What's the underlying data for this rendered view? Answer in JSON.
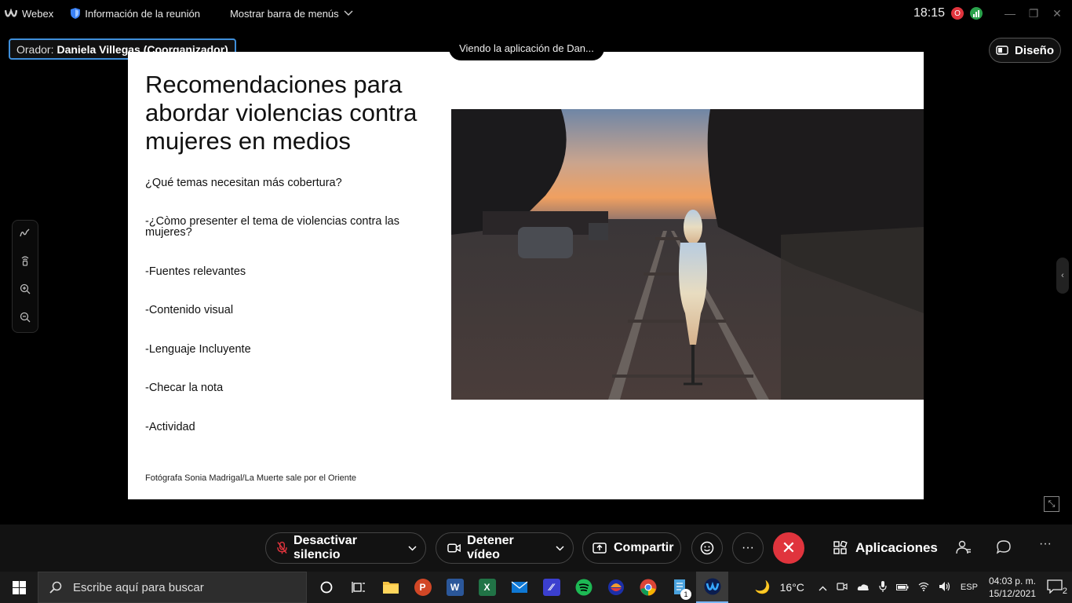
{
  "window": {
    "app_name": "Webex",
    "meeting_info": "Información de la reunión",
    "menu_bar": "Mostrar barra de menús",
    "clock": "18:15",
    "rec_badge": "O"
  },
  "presenter": {
    "prefix": "Orador:",
    "name": "Daniela Villegas (Coorganizador)"
  },
  "viewing_label": "Viendo la aplicación de Dan...",
  "layout_button": "Diseño",
  "slide": {
    "title": "Recomendaciones para abordar violencias contra mujeres en medios",
    "bullets": [
      "¿Qué temas necesitan más cobertura?",
      "-¿Còmo presenter el tema de violencias contra las mujeres?",
      "-Fuentes relevantes",
      "-Contenido visual",
      "-Lenguaje Incluyente",
      "-Checar la nota",
      "-Actividad"
    ],
    "credit": "Fotógrafa Sonia Madrigal/La Muerte sale por el Oriente"
  },
  "controls": {
    "mute": "Desactivar silencio",
    "video": "Detener vídeo",
    "share": "Compartir",
    "apps": "Aplicaciones"
  },
  "taskbar": {
    "search_placeholder": "Escribe aquí para buscar",
    "weather": "16°C",
    "lang": "ESP",
    "time": "04:03 p. m.",
    "date": "15/12/2021",
    "notifications": "2",
    "badge_count": "1"
  }
}
